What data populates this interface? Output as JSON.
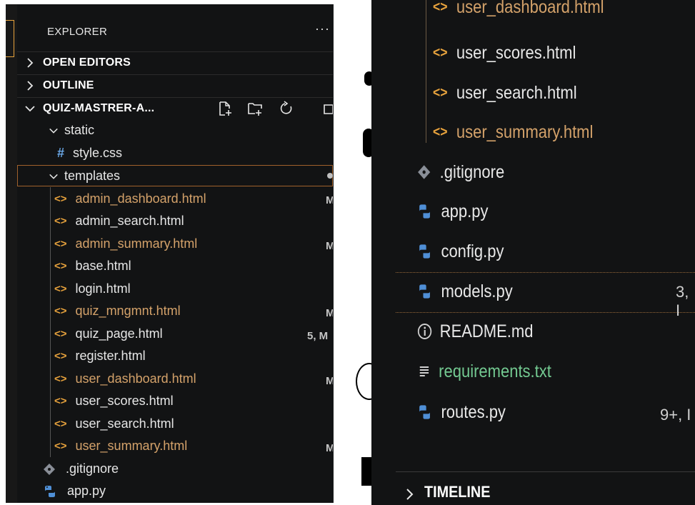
{
  "left": {
    "explorer_title": "EXPLORER",
    "more_actions": "···",
    "sections": {
      "open_editors": "OPEN EDITORS",
      "outline": "OUTLINE",
      "project": "QUIZ-MASTRER-A..."
    },
    "tree": [
      {
        "label": "static",
        "type": "folder"
      },
      {
        "label": "style.css",
        "type": "css",
        "icon_text": "#"
      },
      {
        "label": "templates",
        "type": "folder"
      },
      {
        "label": "admin_dashboard.html",
        "type": "html",
        "modified": true,
        "flag": "M"
      },
      {
        "label": "admin_search.html",
        "type": "html",
        "modified": false,
        "flag": ""
      },
      {
        "label": "admin_summary.html",
        "type": "html",
        "modified": true,
        "flag": "M"
      },
      {
        "label": "base.html",
        "type": "html",
        "modified": false,
        "flag": ""
      },
      {
        "label": "login.html",
        "type": "html",
        "modified": false,
        "flag": ""
      },
      {
        "label": "quiz_mngmnt.html",
        "type": "html",
        "modified": true,
        "flag": "M"
      },
      {
        "label": "quiz_page.html",
        "type": "html",
        "modified": false,
        "flag": "5, M"
      },
      {
        "label": "register.html",
        "type": "html",
        "modified": false,
        "flag": ""
      },
      {
        "label": "user_dashboard.html",
        "type": "html",
        "modified": true,
        "flag": "M"
      },
      {
        "label": "user_scores.html",
        "type": "html",
        "modified": false,
        "flag": ""
      },
      {
        "label": "user_search.html",
        "type": "html",
        "modified": false,
        "flag": ""
      },
      {
        "label": "user_summary.html",
        "type": "html",
        "modified": true,
        "flag": "M"
      },
      {
        "label": ".gitignore",
        "type": "git"
      },
      {
        "label": "app.py",
        "type": "python"
      }
    ]
  },
  "right": {
    "tree": [
      {
        "label": "user_dashboard.html",
        "type": "html",
        "modified": true,
        "flag": ""
      },
      {
        "label": "user_scores.html",
        "type": "html",
        "modified": false,
        "flag": ""
      },
      {
        "label": "user_search.html",
        "type": "html",
        "modified": false,
        "flag": ""
      },
      {
        "label": "user_summary.html",
        "type": "html",
        "modified": true,
        "flag": ""
      },
      {
        "label": ".gitignore",
        "type": "git",
        "flag": ""
      },
      {
        "label": "app.py",
        "type": "python",
        "flag": ""
      },
      {
        "label": "config.py",
        "type": "python",
        "flag": ""
      },
      {
        "label": "models.py",
        "type": "python",
        "flag": "3, I"
      },
      {
        "label": "README.md",
        "type": "info",
        "flag": ""
      },
      {
        "label": "requirements.txt",
        "type": "text",
        "flag": ""
      },
      {
        "label": "routes.py",
        "type": "python",
        "flag": "9+, I"
      }
    ],
    "timeline": "TIMELINE"
  },
  "colors": {
    "background": "#121314",
    "modified": "#d4a26a",
    "html_icon": "#e8a33d",
    "python_icon": "#4f8fd6",
    "requirements": "#73c991"
  }
}
